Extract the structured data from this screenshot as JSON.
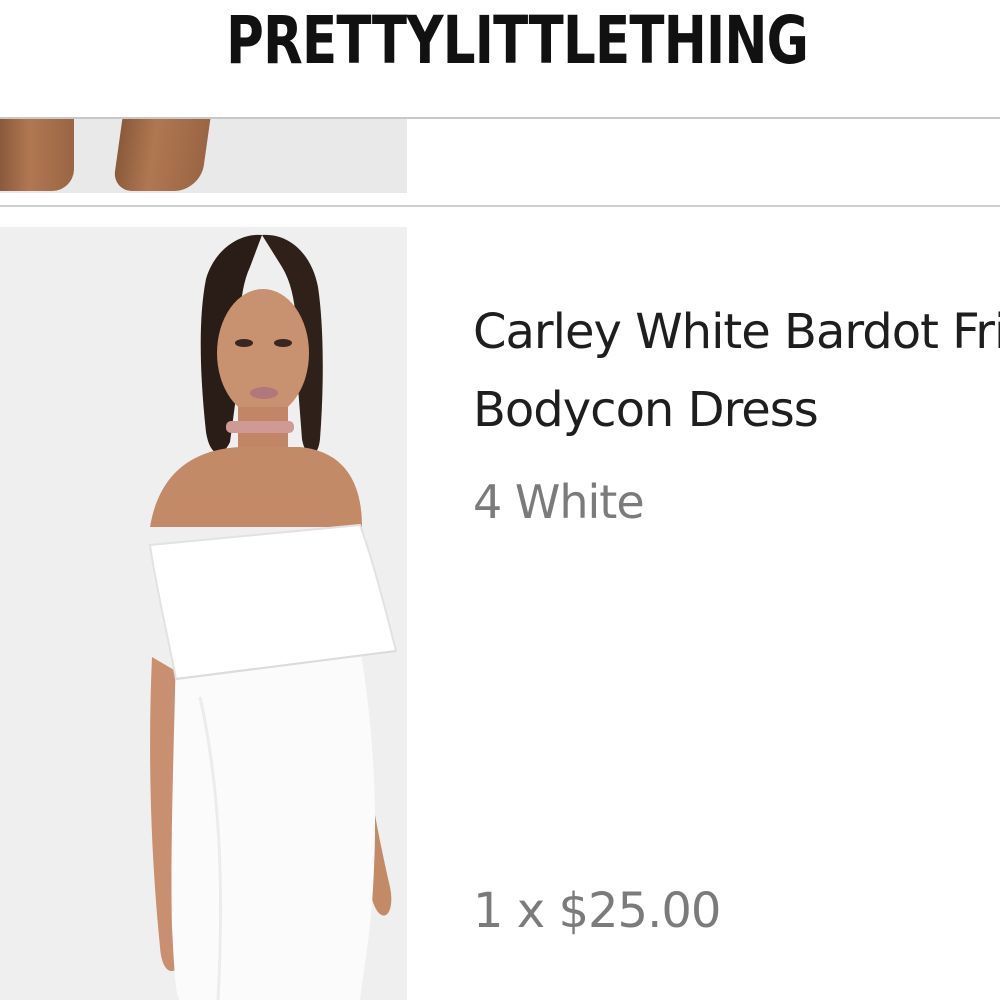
{
  "header": {
    "brand": "PRETTYLITTLETHING"
  },
  "cart": {
    "items": [
      {
        "name_line1": "Carley White Bardot Frill",
        "name_line2": "Bodycon Dress",
        "variant": "4 White",
        "quantity_price": "1 x $25.00"
      }
    ]
  },
  "colors": {
    "text_primary": "#1e1e1e",
    "text_secondary": "#7b7b7b",
    "divider": "#c8c8c8",
    "thumb_background": "#efefef"
  },
  "icons": [
    "product-image-thumbnail"
  ]
}
